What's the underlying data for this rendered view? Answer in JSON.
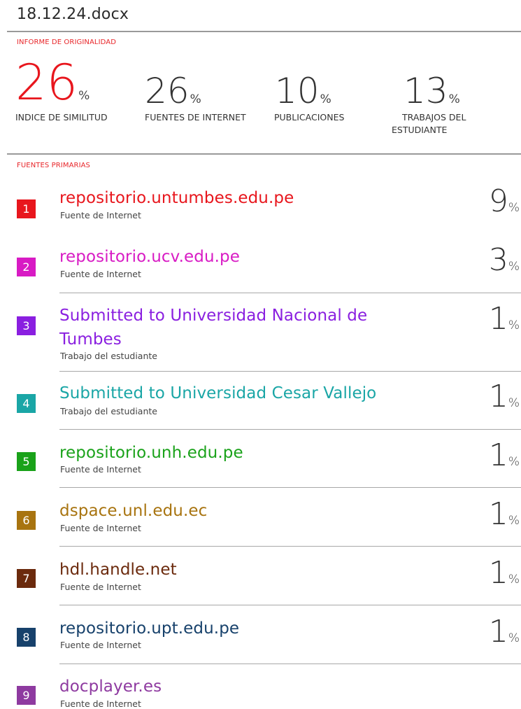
{
  "document": {
    "title": "18.12.24.docx"
  },
  "report": {
    "heading": "INFORME DE ORIGINALIDAD",
    "stats": [
      {
        "value": "26",
        "unit": "%",
        "label": "INDICE DE SIMILITUD"
      },
      {
        "value": "26",
        "unit": "%",
        "label": "FUENTES DE INTERNET"
      },
      {
        "value": "10",
        "unit": "%",
        "label": "PUBLICACIONES"
      },
      {
        "value": "13",
        "unit": "%",
        "label_line1": "TRABAJOS DEL",
        "label_line2": "ESTUDIANTE"
      }
    ]
  },
  "sources": {
    "heading": "FUENTES PRIMARIAS",
    "items": [
      {
        "rank": "1",
        "name": "repositorio.untumbes.edu.pe",
        "type": "Fuente de Internet",
        "percent": "9",
        "unit": "%",
        "color": "#e8161d"
      },
      {
        "rank": "2",
        "name": "repositorio.ucv.edu.pe",
        "type": "Fuente de Internet",
        "percent": "3",
        "unit": "%",
        "color": "#d81bc4"
      },
      {
        "rank": "3",
        "name_line1": "Submitted to Universidad Nacional de",
        "name_line2": "Tumbes",
        "type": "Trabajo del estudiante",
        "percent": "1",
        "unit": "%",
        "color": "#8a1fe0"
      },
      {
        "rank": "4",
        "name": "Submitted to Universidad Cesar Vallejo",
        "type": "Trabajo del estudiante",
        "percent": "1",
        "unit": "%",
        "color": "#1aa6a6"
      },
      {
        "rank": "5",
        "name": "repositorio.unh.edu.pe",
        "type": "Fuente de Internet",
        "percent": "1",
        "unit": "%",
        "color": "#1aa21a"
      },
      {
        "rank": "6",
        "name": "dspace.unl.edu.ec",
        "type": "Fuente de Internet",
        "percent": "1",
        "unit": "%",
        "color": "#a87410"
      },
      {
        "rank": "7",
        "name": "hdl.handle.net",
        "type": "Fuente de Internet",
        "percent": "1",
        "unit": "%",
        "color": "#6b2a0d"
      },
      {
        "rank": "8",
        "name": "repositorio.upt.edu.pe",
        "type": "Fuente de Internet",
        "percent": "1",
        "unit": "%",
        "color": "#17416b"
      },
      {
        "rank": "9",
        "name": "docplayer.es",
        "type": "Fuente de Internet",
        "color": "#8e3aa0"
      }
    ]
  }
}
